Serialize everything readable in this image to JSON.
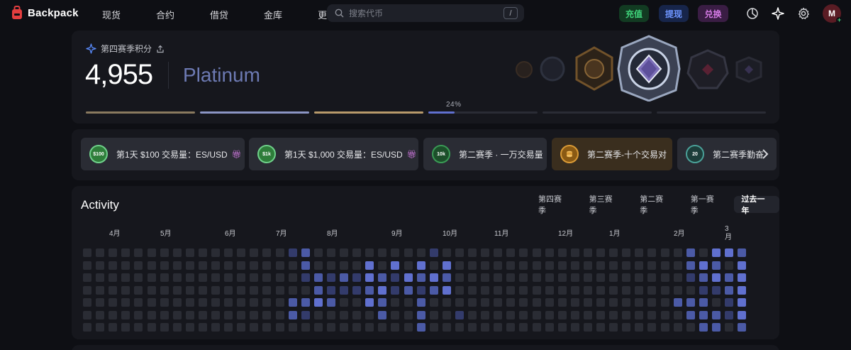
{
  "nav": {
    "brand": "Backpack",
    "links": [
      {
        "label": "现货"
      },
      {
        "label": "合约"
      },
      {
        "label": "借贷"
      },
      {
        "label": "金库"
      },
      {
        "label": "更多"
      }
    ],
    "search_placeholder": "搜索代币",
    "search_shortcut": "/",
    "deposit": "充值",
    "withdraw": "提现",
    "convert": "兑换",
    "avatar_initial": "M"
  },
  "season": {
    "label": "第四赛季积分",
    "points": "4,955",
    "tier": "Platinum",
    "progress_percent": "24%",
    "tier_progress": [
      1,
      1,
      1,
      0.24,
      0,
      0
    ]
  },
  "challenges": [
    {
      "title": "第1天 $100 交易量：ES/USD",
      "badge": "$100",
      "gift": true
    },
    {
      "title": "第1天 $1,000 交易量：ES/USD",
      "badge": "$1k",
      "gift": true
    },
    {
      "title": "第二赛季 · 一万交易量",
      "badge": "10k",
      "gift": false
    },
    {
      "title": "第二赛季-十个交易对",
      "badge": "",
      "gift": false
    },
    {
      "title": "第二赛季勤奋",
      "badge": "20",
      "gift": false
    }
  ],
  "activity": {
    "title": "Activity",
    "tabs": [
      "第四赛季",
      "第三赛季",
      "第二赛季",
      "第一赛季",
      "过去一年"
    ],
    "active_tab": "过去一年",
    "months": [
      "4月",
      "5月",
      "6月",
      "7月",
      "8月",
      "9月",
      "10月",
      "11月",
      "12月",
      "1月",
      "2月",
      "3\n月"
    ],
    "rows": 7,
    "cols": 52,
    "heatmap": [
      [
        0,
        0,
        0,
        0,
        0,
        0,
        0,
        0,
        0,
        0,
        0,
        0,
        0,
        0,
        0,
        0,
        1,
        2,
        0,
        0,
        0,
        0,
        0,
        0,
        0,
        0,
        0,
        1,
        0,
        0,
        0,
        0,
        0,
        0,
        0,
        0,
        0,
        0,
        0,
        0,
        0,
        0,
        0,
        0,
        0,
        0,
        0,
        2,
        0,
        3,
        3,
        2,
        3
      ],
      [
        0,
        0,
        0,
        0,
        0,
        0,
        0,
        0,
        0,
        0,
        0,
        0,
        0,
        0,
        0,
        0,
        0,
        2,
        0,
        0,
        0,
        0,
        3,
        0,
        3,
        0,
        3,
        0,
        3,
        0,
        0,
        0,
        0,
        0,
        0,
        0,
        0,
        0,
        0,
        0,
        0,
        0,
        0,
        0,
        0,
        0,
        0,
        2,
        3,
        2,
        0,
        3,
        3
      ],
      [
        0,
        0,
        0,
        0,
        0,
        0,
        0,
        0,
        0,
        0,
        0,
        0,
        0,
        0,
        0,
        0,
        0,
        1,
        2,
        1,
        2,
        1,
        3,
        2,
        1,
        3,
        2,
        3,
        2,
        0,
        0,
        0,
        0,
        0,
        0,
        0,
        0,
        0,
        0,
        0,
        0,
        0,
        0,
        0,
        0,
        0,
        0,
        1,
        2,
        3,
        2,
        3,
        3
      ],
      [
        0,
        0,
        0,
        0,
        0,
        0,
        0,
        0,
        0,
        0,
        0,
        0,
        0,
        0,
        0,
        0,
        0,
        0,
        2,
        1,
        1,
        1,
        2,
        3,
        1,
        2,
        1,
        2,
        3,
        0,
        0,
        0,
        0,
        0,
        0,
        0,
        0,
        0,
        0,
        0,
        0,
        0,
        0,
        0,
        0,
        0,
        0,
        0,
        1,
        1,
        2,
        3,
        3
      ],
      [
        0,
        0,
        0,
        0,
        0,
        0,
        0,
        0,
        0,
        0,
        0,
        0,
        0,
        0,
        0,
        0,
        2,
        2,
        3,
        2,
        0,
        0,
        3,
        2,
        0,
        0,
        2,
        0,
        0,
        0,
        0,
        0,
        0,
        0,
        0,
        0,
        0,
        0,
        0,
        0,
        0,
        0,
        0,
        0,
        0,
        0,
        2,
        2,
        2,
        0,
        1,
        3,
        2
      ],
      [
        0,
        0,
        0,
        0,
        0,
        0,
        0,
        0,
        0,
        0,
        0,
        0,
        0,
        0,
        0,
        0,
        2,
        1,
        0,
        0,
        0,
        0,
        0,
        2,
        0,
        0,
        2,
        0,
        0,
        1,
        0,
        0,
        0,
        0,
        0,
        0,
        0,
        0,
        0,
        0,
        0,
        0,
        0,
        0,
        0,
        0,
        0,
        2,
        2,
        2,
        1,
        3,
        0
      ],
      [
        0,
        0,
        0,
        0,
        0,
        0,
        0,
        0,
        0,
        0,
        0,
        0,
        0,
        0,
        0,
        0,
        0,
        0,
        0,
        0,
        0,
        0,
        0,
        0,
        0,
        0,
        2,
        0,
        0,
        0,
        0,
        0,
        0,
        0,
        0,
        0,
        0,
        0,
        0,
        0,
        0,
        0,
        0,
        0,
        0,
        0,
        0,
        0,
        2,
        2,
        0,
        2,
        0
      ]
    ]
  },
  "colors": {
    "accent": "#6d7ab3",
    "deposit": "#3fd27a",
    "withdraw": "#6d95ff",
    "convert": "#d67be6",
    "heat_0": "#2a2c34",
    "heat_1": "#333b6b",
    "heat_2": "#4b5aa6",
    "heat_3": "#6070cf"
  },
  "icons": [
    "backpack-logo-icon",
    "search-icon",
    "chevron-down-icon",
    "pie-chart-icon",
    "sparkle-icon",
    "gear-icon",
    "sparkle-small-icon",
    "share-icon",
    "gift-icon",
    "chevron-right-icon"
  ]
}
